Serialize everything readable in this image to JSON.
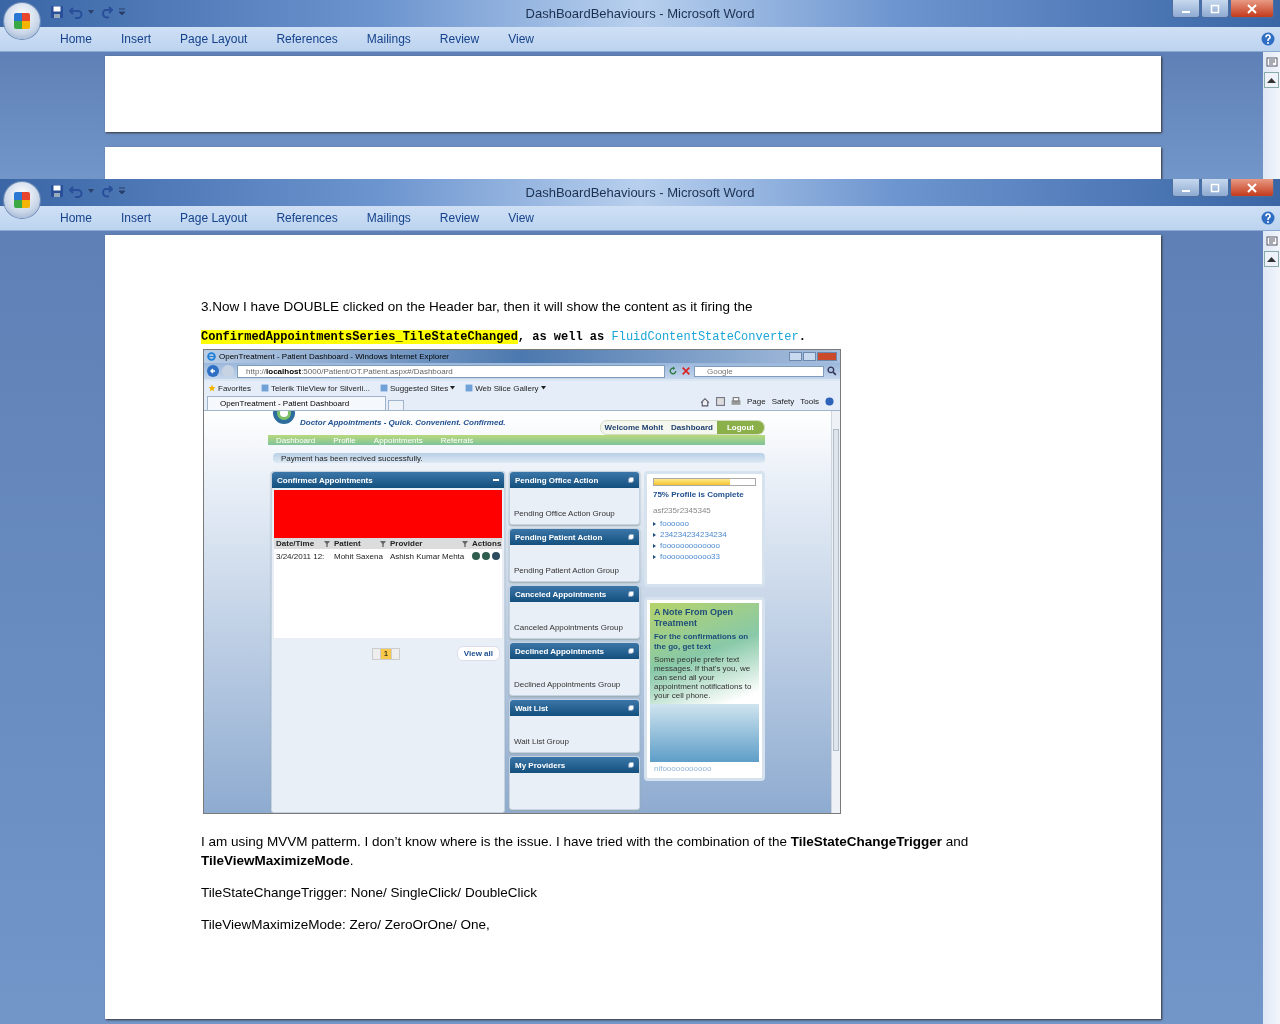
{
  "word_windows": [
    {
      "title": "DashBoardBehaviours - Microsoft Word",
      "tabs": [
        "Home",
        "Insert",
        "Page Layout",
        "References",
        "Mailings",
        "Review",
        "View"
      ]
    },
    {
      "title": "DashBoardBehaviours - Microsoft Word",
      "tabs": [
        "Home",
        "Insert",
        "Page Layout",
        "References",
        "Mailings",
        "Review",
        "View"
      ]
    }
  ],
  "document": {
    "intro": "3.Now I have DOUBLE clicked on the Header bar, then it will show the content as it firing the",
    "code_line": [
      {
        "kind": "highlight",
        "text": "ConfirmedAppointmentsSeries_TileStateChanged"
      },
      {
        "kind": "plain",
        "text": ", as well as "
      },
      {
        "kind": "link",
        "text": "FluidContentStateConverter"
      },
      {
        "kind": "plain",
        "text": "."
      }
    ],
    "browser": {
      "title": "OpenTreatment - Patient Dashboard - Windows Internet Explorer",
      "address": "http://**localhost**:5000/Patient/OT.Patient.aspx#/Dashboard",
      "search_placeholder": "Google",
      "favorites": [
        {
          "label": "Favorites",
          "has_menu": false
        },
        {
          "label": "Telerik TileView for Silverli...",
          "has_menu": false
        },
        {
          "label": "Suggested Sites",
          "has_menu": true
        },
        {
          "label": "Web Slice Gallery",
          "has_menu": true
        }
      ],
      "tab": "OpenTreatment - Patient Dashboard",
      "commands": [
        "Page",
        "Safety",
        "Tools"
      ],
      "site": {
        "tagline": "Doctor Appointments - Quick. Convenient. Confirmed.",
        "user_links": [
          "Welcome Mohit",
          "Dashboard",
          "Logout"
        ],
        "nav": [
          "Dashboard",
          "Profile",
          "Appointments",
          "Referrals"
        ],
        "message": "Payment has been recived successfully.",
        "confirmed": {
          "title": "Confirmed Appointments",
          "columns": [
            {
              "label": "Date/Time",
              "filter": true
            },
            {
              "label": "Patient",
              "filter": true
            },
            {
              "label": "Provider",
              "filter": true
            },
            {
              "label": "Actions",
              "filter": false
            }
          ],
          "rows": [
            {
              "date": "3/24/2011 12:",
              "patient": "Mohit  Saxena",
              "provider": "Ashish Kumar Mehta"
            }
          ],
          "page": "1",
          "view_all": "View all"
        },
        "tiles": [
          {
            "title": "Pending Office Action",
            "group": "Pending Office Action Group"
          },
          {
            "title": "Pending Patient Action",
            "group": "Pending Patient Action Group"
          },
          {
            "title": "Canceled Appointments",
            "group": "Canceled Appointments Group"
          },
          {
            "title": "Declined Appointments",
            "group": "Declined Appointments Group"
          },
          {
            "title": "Wait List",
            "group": "Wait List Group"
          },
          {
            "title": "My Providers"
          }
        ],
        "profile": {
          "level": 0.75,
          "caption": "75% Profile is Complete",
          "code": "asf235r2345345",
          "links": [
            "foooooo",
            "234234234234234",
            "fooooooooooooo",
            "fooooooooooo33"
          ]
        },
        "note": {
          "title": "A Note From Open Treatment",
          "subtitle": "For the confirmations on the go, get text",
          "body": "Some people prefer text messages. If that's you, we can send all your appointment notifications to your cell phone.",
          "footer": "nifooooooooooo"
        }
      }
    },
    "paragraphs": [
      "I am using MVVM patterm. I don’t know where is the issue. I have tried with the combination of the **TileStateChangeTrigger** and **TileViewMaximizeMode**.",
      "TileStateChangeTrigger: None/ SingleClick/ DoubleClick",
      "TileViewMaximizeMode: Zero/ ZeroOrOne/ One,"
    ]
  }
}
